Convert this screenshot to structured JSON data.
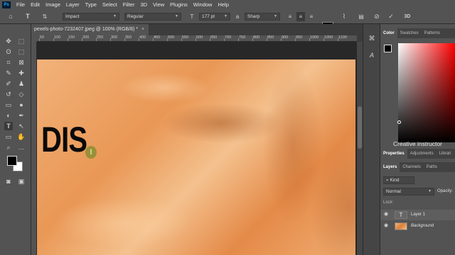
{
  "menu": {
    "logo": "Ps",
    "items": [
      "File",
      "Edit",
      "Image",
      "Layer",
      "Type",
      "Select",
      "Filter",
      "3D",
      "View",
      "Plugins",
      "Window",
      "Help"
    ]
  },
  "options": {
    "font_family": "Impact",
    "font_style": "Regular",
    "font_size": "177 pt",
    "antialias": "Sharp",
    "three_d": "3D"
  },
  "document": {
    "tab_title": "pexels-photo-7232407.jpeg @ 100% (RGB/8) *",
    "tab_close": "×",
    "ruler_labels": [
      "50",
      "100",
      "150",
      "200",
      "250",
      "300",
      "350",
      "400",
      "450",
      "500",
      "550",
      "600",
      "650",
      "700",
      "750",
      "800",
      "850",
      "900",
      "950",
      "1000",
      "1050",
      "1100",
      "1150"
    ],
    "canvas_text": "DIS"
  },
  "panels": {
    "color_tabs": [
      "Color",
      "Swatches",
      "Patterns"
    ],
    "watermark": "Creative instructor",
    "properties_tabs": [
      "Properties",
      "Adjustments",
      "Librari"
    ],
    "layers_tabs": [
      "Layers",
      "Channels",
      "Paths"
    ],
    "kind_placeholder": "Kind",
    "blend_mode": "Normal",
    "opacity_label": "Opacity:",
    "lock_label": "Lock:",
    "layers": [
      {
        "name": "Layer 1",
        "type": "text"
      },
      {
        "name": "Background",
        "type": "image"
      }
    ]
  },
  "colors": {
    "accent": "#31a8ff",
    "fabric": "#e99755",
    "foreground": "#000000",
    "background": "#ffffff"
  }
}
